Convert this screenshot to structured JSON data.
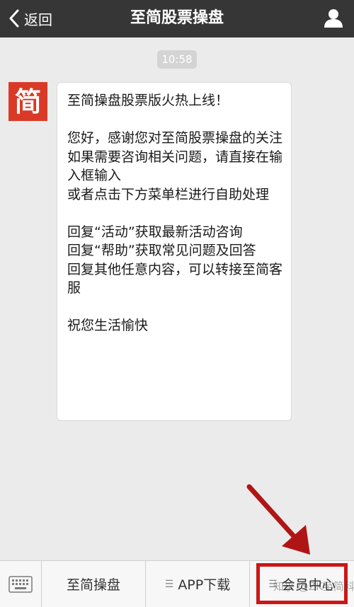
{
  "nav": {
    "back_label": "返回",
    "title": "至简股票操盘"
  },
  "chat": {
    "timestamp": "10:58",
    "avatar_char": "简",
    "message": "至简操盘股票版火热上线！\n\n您好，感谢您对至简股票操盘的关注\n如果需要咨询相关问题，请直接在输入框输入\n或者点击下方菜单栏进行自助处理\n\n回复“活动”获取最新活动咨询\n回复“帮助”获取常见问题及回答\n回复其他任意内容，可以转接至简客服\n\n祝您生活愉快"
  },
  "menu": {
    "items": [
      {
        "label": "至简操盘",
        "has_submenu_icon": false
      },
      {
        "label": "APP下载",
        "has_submenu_icon": true
      },
      {
        "label": "会员中心",
        "has_submenu_icon": true
      }
    ]
  },
  "watermark": "知乎 @ZK至简科技",
  "colors": {
    "nav_bg": "#363636",
    "avatar_bg": "#d93a27",
    "annotation": "#cc1717"
  },
  "icons": {
    "back": "chevron-left-icon",
    "profile": "person-icon",
    "keyboard": "keyboard-icon",
    "submenu": "menu-lines-icon"
  }
}
